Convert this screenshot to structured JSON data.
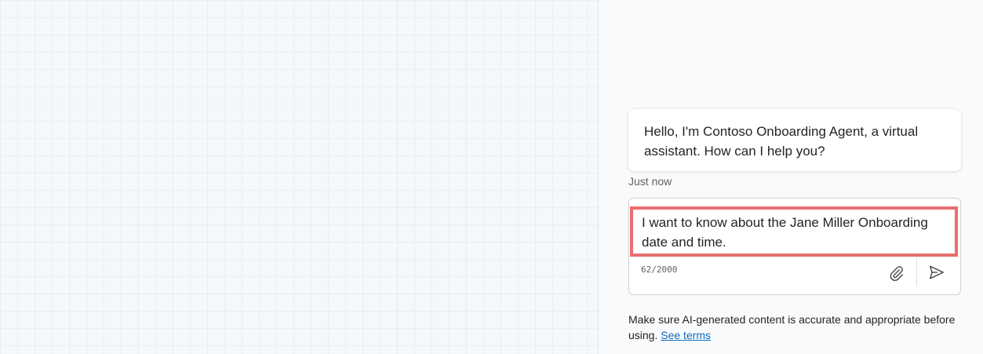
{
  "chat": {
    "bot_message": "Hello, I'm Contoso Onboarding Agent, a virtual assistant. How can I help you?",
    "timestamp": "Just now"
  },
  "composer": {
    "text": "I want to know about the Jane Miller Onboarding date and time.",
    "char_count": "62/2000",
    "attach_icon": "paperclip-icon",
    "send_icon": "send-icon",
    "highlight_color": "#e96e6e"
  },
  "disclaimer": {
    "text": "Make sure AI-generated content is accurate and appropriate before using.",
    "link_label": "See terms"
  },
  "colors": {
    "link": "#0f6cbd",
    "bubble_bg": "#ffffff",
    "pane_bg": "#f9fafc"
  }
}
